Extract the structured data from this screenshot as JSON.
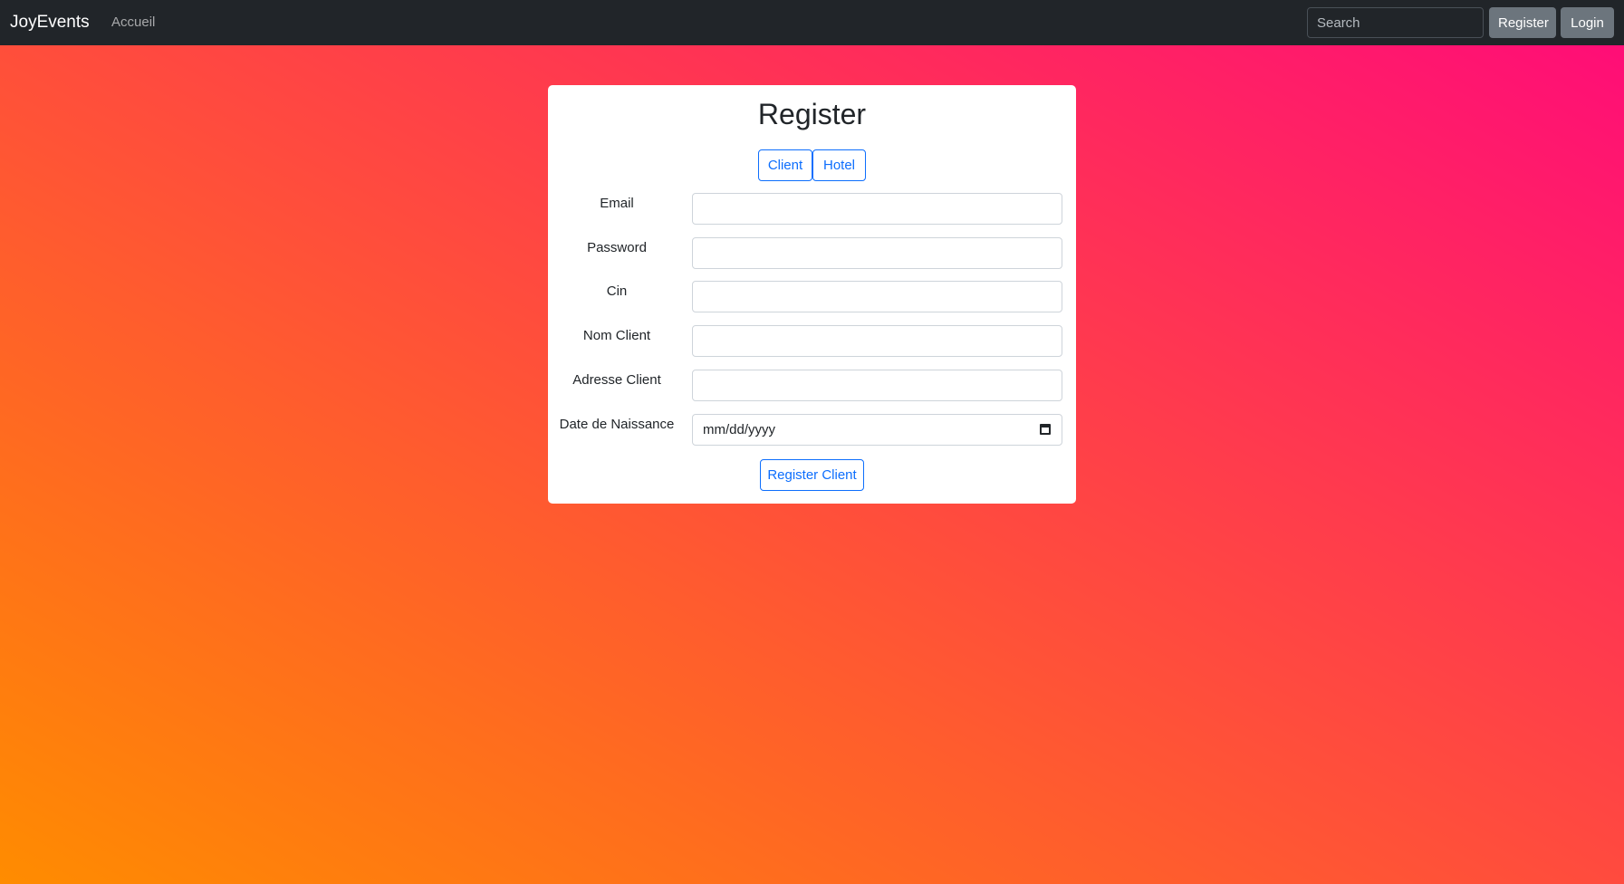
{
  "navbar": {
    "brand": "JoyEvents",
    "links": [
      "Accueil"
    ],
    "search_placeholder": "Search",
    "register_label": "Register",
    "login_label": "Login"
  },
  "form": {
    "title": "Register",
    "tabs": [
      {
        "label": "Client",
        "active": true
      },
      {
        "label": "Hotel",
        "active": false
      }
    ],
    "fields": [
      {
        "label": "Email",
        "type": "email",
        "value": ""
      },
      {
        "label": "Password",
        "type": "password",
        "value": ""
      },
      {
        "label": "Cin",
        "type": "text",
        "value": ""
      },
      {
        "label": "Nom Client",
        "type": "text",
        "value": ""
      },
      {
        "label": "Adresse Client",
        "type": "text",
        "value": ""
      },
      {
        "label": "Date de Naissance",
        "type": "date",
        "placeholder": "mm/dd/yyyy",
        "value": ""
      }
    ],
    "submit_label": "Register Client"
  },
  "colors": {
    "navbar_bg": "#212529",
    "primary": "#0d6efd",
    "secondary_button": "#6c757d",
    "gradient_start": "#ff8c00",
    "gradient_mid": "#ff4b3e",
    "gradient_end": "#ff0a7a"
  }
}
